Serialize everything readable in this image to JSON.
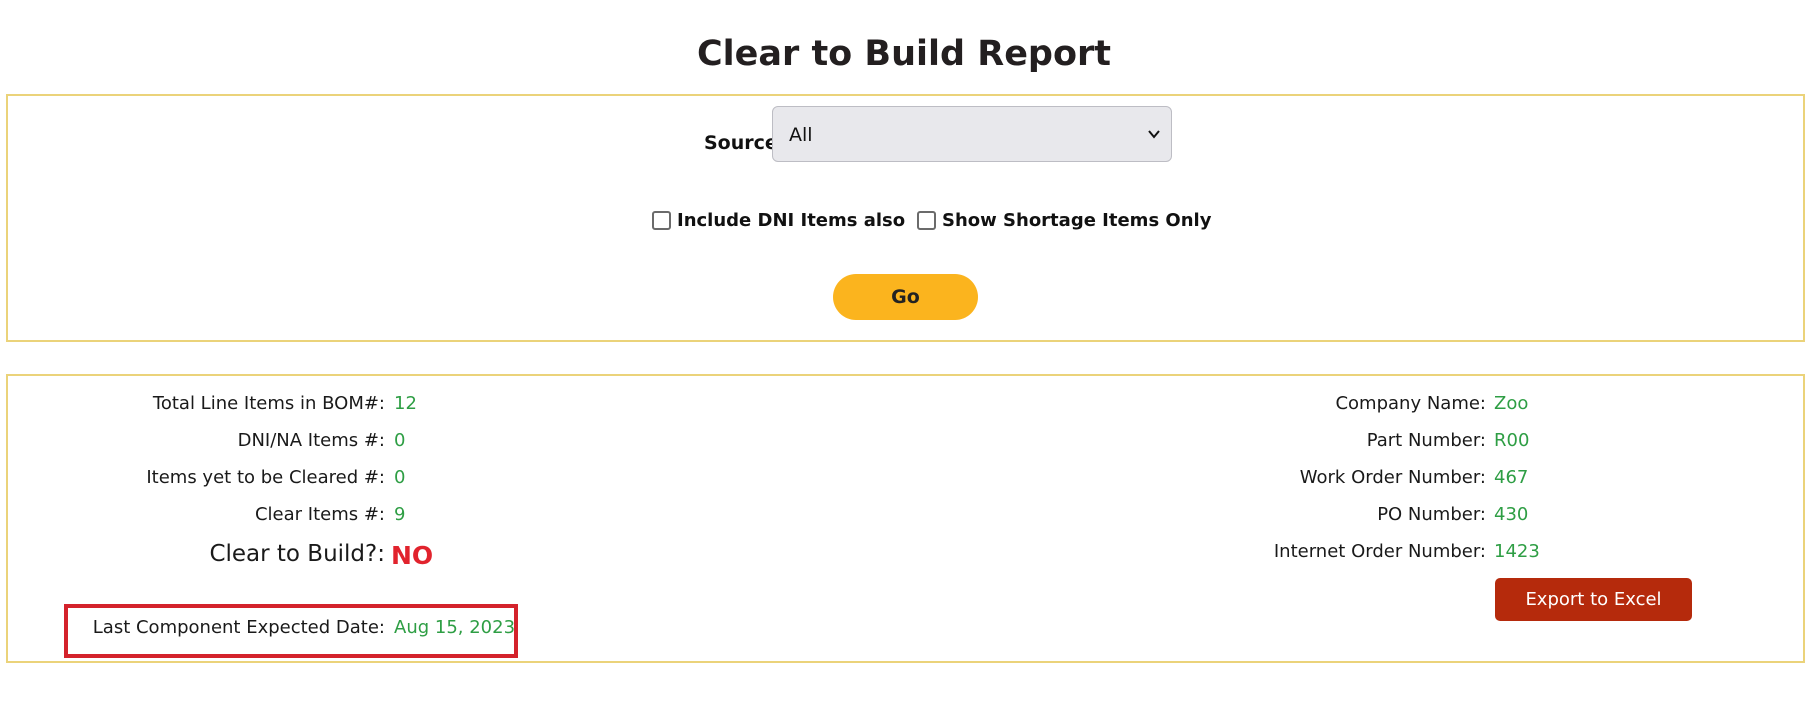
{
  "page": {
    "title": "Clear to Build Report"
  },
  "filters": {
    "source_label": "Source",
    "source_value": "All",
    "include_dni_label": "Include DNI Items also",
    "show_shortage_label": "Show Shortage Items Only",
    "go_label": "Go"
  },
  "summary": {
    "left": [
      {
        "label": "Total Line Items in BOM#:",
        "value": "12"
      },
      {
        "label": "DNI/NA Items #:",
        "value": "0"
      },
      {
        "label": "Items yet to be Cleared #:",
        "value": "0"
      },
      {
        "label": "Clear Items #:",
        "value": "9"
      }
    ],
    "clear_to_build": {
      "label": "Clear to Build?:",
      "value": "NO"
    },
    "last_component": {
      "label": "Last Component Expected Date:",
      "value": "Aug 15, 2023"
    },
    "right": [
      {
        "label": "Company Name:",
        "value": "Zoo"
      },
      {
        "label": "Part Number:",
        "value": "R00"
      },
      {
        "label": "Work Order Number:",
        "value": "467"
      },
      {
        "label": "PO Number:",
        "value": "430"
      },
      {
        "label": "Internet Order Number:",
        "value": "1423"
      }
    ],
    "export_label": "Export to Excel"
  },
  "colors": {
    "accent": "#fbb41e",
    "panel_border": "#ebd37a",
    "value_green": "#2e9e44",
    "status_red": "#e1232d",
    "export_red": "#b52a0c",
    "highlight_red": "#d4222b"
  }
}
